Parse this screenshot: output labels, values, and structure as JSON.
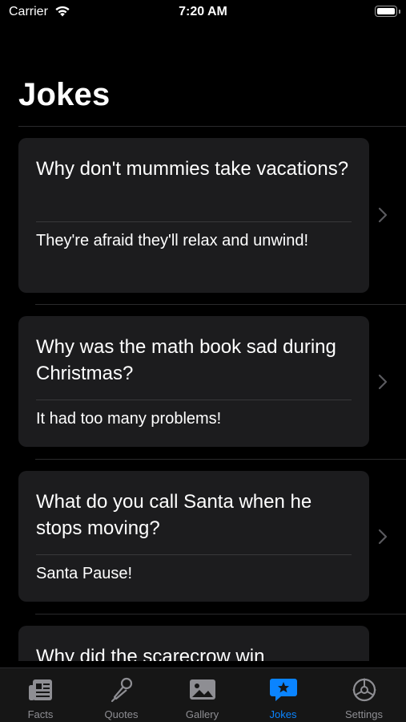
{
  "status": {
    "carrier": "Carrier",
    "time": "7:20 AM"
  },
  "title": "Jokes",
  "jokes": [
    {
      "question": "Why don't mummies take vacations?",
      "answer": "They're afraid they'll relax and unwind!"
    },
    {
      "question": "Why was the math book sad during Christmas?",
      "answer": "It had too many problems!"
    },
    {
      "question": "What do you call Santa when he stops moving?",
      "answer": "Santa Pause!"
    },
    {
      "question": "Why did the scarecrow win",
      "answer": ""
    }
  ],
  "tabs": [
    {
      "label": "Facts",
      "icon": "newspaper-icon"
    },
    {
      "label": "Quotes",
      "icon": "microphone-icon"
    },
    {
      "label": "Gallery",
      "icon": "photo-icon"
    },
    {
      "label": "Jokes",
      "icon": "star-bubble-icon",
      "active": true
    },
    {
      "label": "Settings",
      "icon": "gear-icon"
    }
  ],
  "colors": {
    "accent": "#0a84ff",
    "inactive": "#8e8e93",
    "card": "#1c1c1e",
    "background": "#000000"
  }
}
